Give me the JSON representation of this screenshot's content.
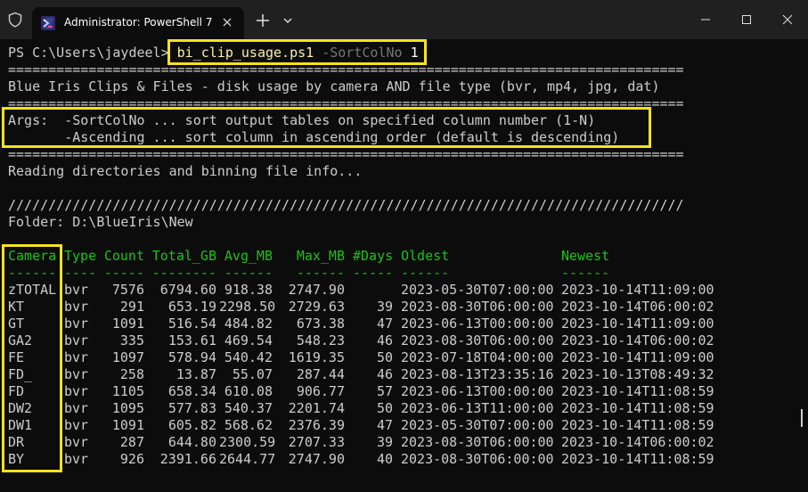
{
  "window": {
    "tab_title": "Administrator: PowerShell 7"
  },
  "terminal": {
    "prompt": "PS C:\\Users\\jaydeel>",
    "command": "bi_clip_usage.ps1",
    "param": "-SortColNo",
    "param_value": "1",
    "rule": "====================================================================================",
    "title_line": "Blue Iris Clips & Files - disk usage by camera AND file type (bvr, mp4, jpg, dat)",
    "args_line1": "Args:  -SortColNo ... sort output tables on specified column number (1-N)",
    "args_line2": "       -Ascending ... sort column in ascending order (default is descending)",
    "reading": "Reading directories and binning file info...",
    "slashes": "////////////////////////////////////////////////////////////////////////////////////",
    "folder": "Folder: D:\\BlueIris\\New"
  },
  "table": {
    "headers": [
      "Camera",
      "Type",
      "Count",
      "Total_GB",
      "Avg_MB",
      "Max_MB",
      "#Days",
      "Oldest",
      "Newest"
    ],
    "underlines": [
      "------",
      "----",
      "-----",
      "--------",
      "------",
      "------",
      "-----",
      "------",
      "------"
    ],
    "rows": [
      [
        "zTOTAL",
        "bvr",
        "7576",
        "6794.60",
        "918.38",
        "2747.90",
        "",
        "2023-05-30T07:00:00",
        "2023-10-14T11:09:00"
      ],
      [
        "KT",
        "bvr",
        "291",
        "653.19",
        "2298.50",
        "2729.63",
        "39",
        "2023-08-30T06:00:00",
        "2023-10-14T06:00:02"
      ],
      [
        "GT",
        "bvr",
        "1091",
        "516.54",
        "484.82",
        "673.38",
        "47",
        "2023-06-13T00:00:00",
        "2023-10-14T11:09:00"
      ],
      [
        "GA2",
        "bvr",
        "335",
        "153.61",
        "469.54",
        "548.23",
        "46",
        "2023-08-30T06:00:00",
        "2023-10-14T06:00:02"
      ],
      [
        "FE",
        "bvr",
        "1097",
        "578.94",
        "540.42",
        "1619.35",
        "50",
        "2023-07-18T04:00:00",
        "2023-10-14T11:09:00"
      ],
      [
        "FD_",
        "bvr",
        "258",
        "13.87",
        "55.07",
        "287.44",
        "46",
        "2023-08-13T23:35:16",
        "2023-10-13T08:49:32"
      ],
      [
        "FD",
        "bvr",
        "1105",
        "658.34",
        "610.08",
        "906.77",
        "57",
        "2023-06-13T00:00:00",
        "2023-10-14T11:08:59"
      ],
      [
        "DW2",
        "bvr",
        "1095",
        "577.83",
        "540.37",
        "2201.74",
        "50",
        "2023-06-13T11:00:00",
        "2023-10-14T11:08:59"
      ],
      [
        "DW1",
        "bvr",
        "1091",
        "605.82",
        "568.62",
        "2376.39",
        "47",
        "2023-05-30T07:00:00",
        "2023-10-14T11:08:59"
      ],
      [
        "DR",
        "bvr",
        "287",
        "644.80",
        "2300.59",
        "2707.33",
        "39",
        "2023-08-30T06:00:00",
        "2023-10-14T06:00:02"
      ],
      [
        "BY",
        "bvr",
        "926",
        "2391.66",
        "2644.77",
        "2747.90",
        "40",
        "2023-08-30T06:00:00",
        "2023-10-14T11:08:59"
      ]
    ]
  },
  "colors": {
    "highlight": "#f6e21e",
    "header_green": "#16c60c",
    "text": "#cccccc",
    "param": "#767676"
  }
}
